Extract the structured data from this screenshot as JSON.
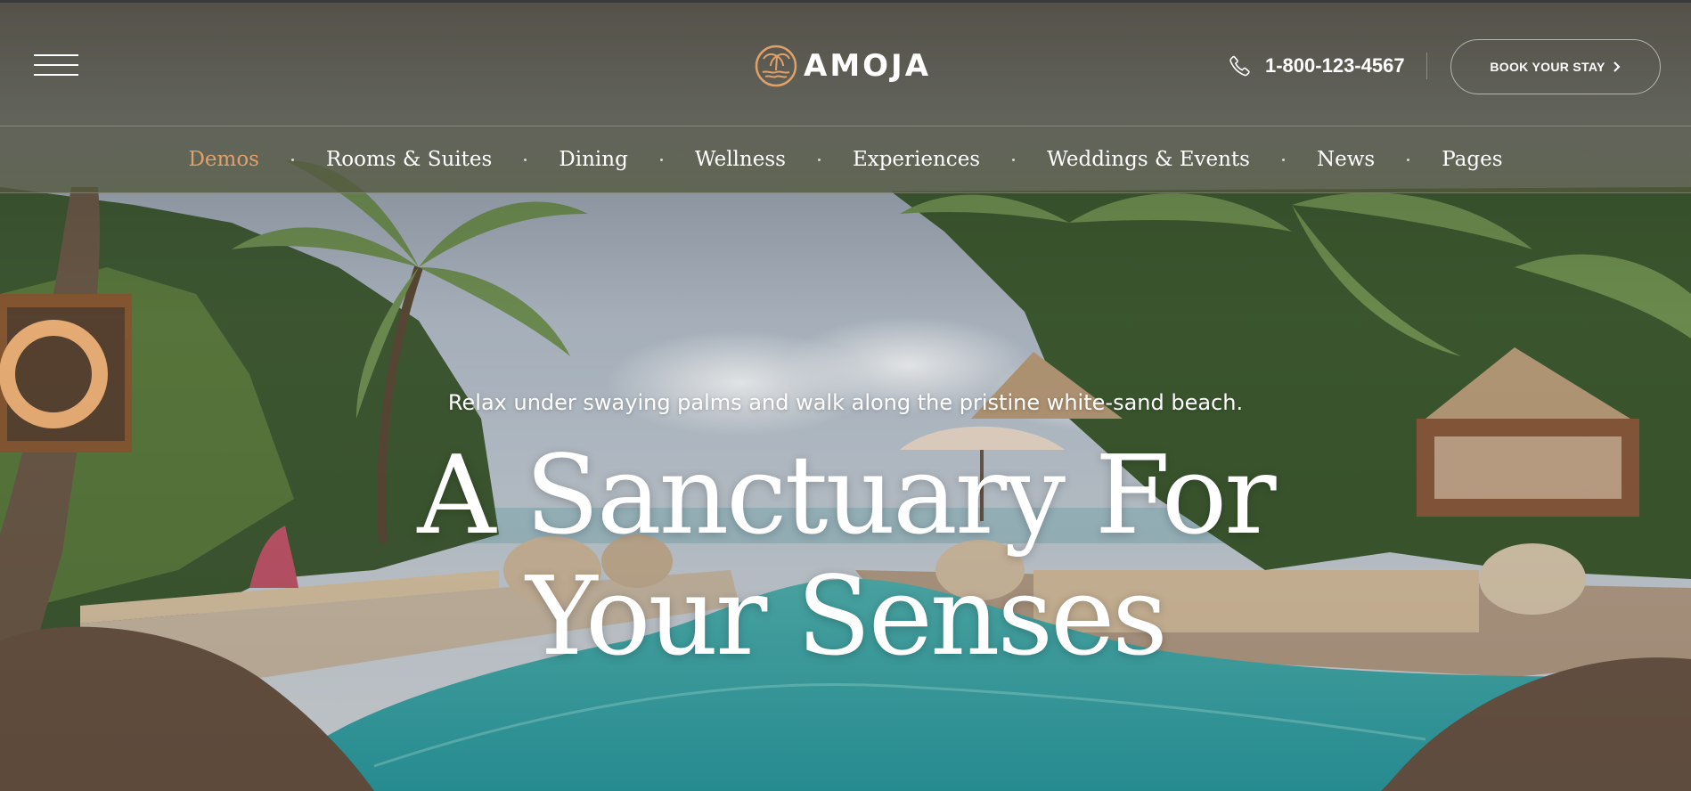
{
  "header": {
    "brand": {
      "name": "AMOJA",
      "logo_icon": "palm-sun-icon",
      "accent_color": "#e0a168"
    },
    "menu_icon": "hamburger-menu-icon",
    "phone": {
      "icon": "phone-icon",
      "number": "1-800-123-4567"
    },
    "book_button": {
      "label": "BOOK YOUR STAY",
      "icon": "chevron-right-icon"
    }
  },
  "nav": {
    "items": [
      {
        "label": "Demos",
        "active": true
      },
      {
        "label": "Rooms & Suites"
      },
      {
        "label": "Dining"
      },
      {
        "label": "Wellness"
      },
      {
        "label": "Experiences"
      },
      {
        "label": "Weddings & Events"
      },
      {
        "label": "News"
      },
      {
        "label": "Pages"
      }
    ],
    "active_color": "#e0a168"
  },
  "hero": {
    "tagline": "Relax under swaying palms and walk along the pristine white-sand beach.",
    "title_line1": "A Sanctuary For",
    "title_line2": "Your Senses"
  }
}
